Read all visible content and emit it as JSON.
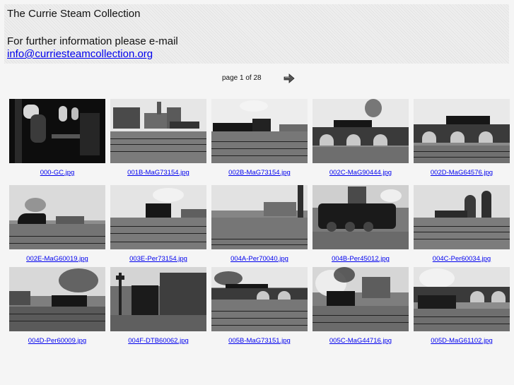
{
  "header": {
    "title": "The Currie Steam Collection",
    "info_text": "For further information please e-mail",
    "email": "info@curriesteamcollection.org"
  },
  "pager": {
    "label": "page 1 of 28",
    "next_icon": "right-arrow-icon"
  },
  "thumbnails": [
    {
      "caption": "000-GC.jpg"
    },
    {
      "caption": "001B-MaG73154.jpg"
    },
    {
      "caption": "002B-MaG73154.jpg"
    },
    {
      "caption": "002C-MaG90444.jpg"
    },
    {
      "caption": "002D-MaG64576.jpg"
    },
    {
      "caption": "002E-MaG60019.jpg"
    },
    {
      "caption": "003E-Per73154.jpg"
    },
    {
      "caption": "004A-Per70040.jpg"
    },
    {
      "caption": "004B-Per45012.jpg"
    },
    {
      "caption": "004C-Per60034.jpg"
    },
    {
      "caption": "004D-Per60009.jpg"
    },
    {
      "caption": "004F-DTB60062.jpg"
    },
    {
      "caption": "005B-MaG73151.jpg"
    },
    {
      "caption": "005C-MaG44716.jpg"
    },
    {
      "caption": "005D-MaG61102.jpg"
    }
  ]
}
